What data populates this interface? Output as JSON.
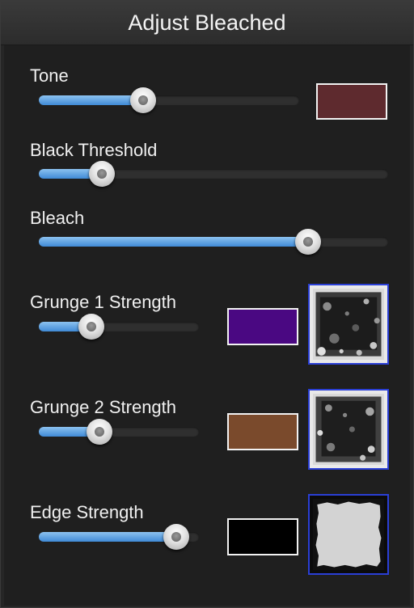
{
  "window": {
    "title": "Adjust Bleached"
  },
  "controls": [
    {
      "id": "tone",
      "label": "Tone",
      "value": 0.4,
      "swatch_color": "#5e2a2e"
    },
    {
      "id": "black_threshold",
      "label": "Black Threshold",
      "value": 0.18
    },
    {
      "id": "bleach",
      "label": "Bleach",
      "value": 0.77
    },
    {
      "id": "grunge1",
      "label": "Grunge 1 Strength",
      "value": 0.33,
      "swatch_color": "#4a0882",
      "texture_icon": "grunge-texture-icon"
    },
    {
      "id": "grunge2",
      "label": "Grunge 2 Strength",
      "value": 0.38,
      "swatch_color": "#7a4a2c",
      "texture_icon": "grunge-texture-icon"
    },
    {
      "id": "edge",
      "label": "Edge Strength",
      "value": 0.86,
      "swatch_color": "#000000",
      "texture_icon": "edge-texture-icon"
    }
  ],
  "colors": {
    "accent": "#4a93dd",
    "texture_border": "#2a3fd6",
    "panel_bg": "#1f1f1f"
  }
}
